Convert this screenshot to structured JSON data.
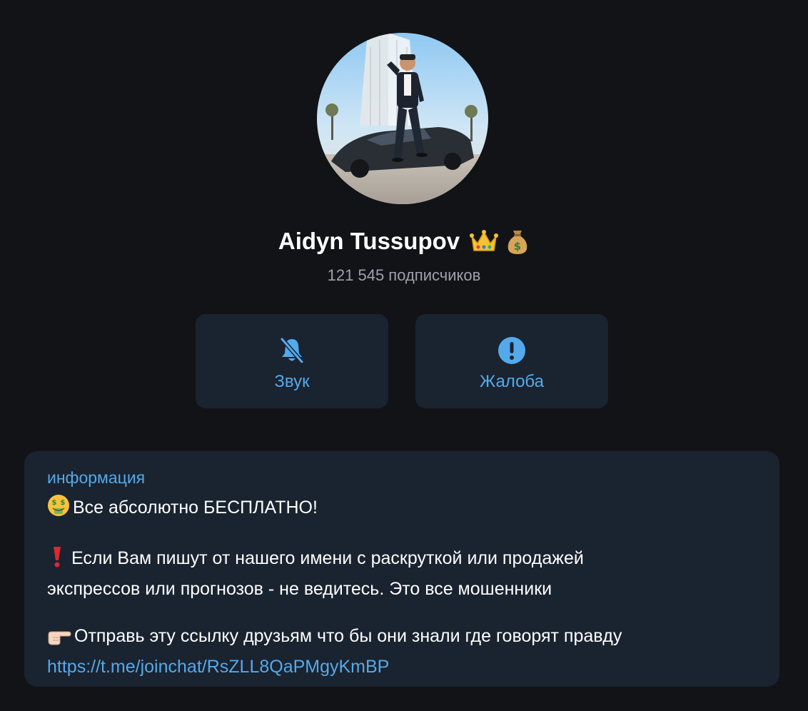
{
  "profile": {
    "name": "Aidyn Tussupov",
    "name_emojis": [
      "crown-emoji",
      "money-bag-emoji"
    ],
    "subscribers": "121 545 подписчиков"
  },
  "actions": {
    "sound_label": "Звук",
    "sound_icon": "bell-muted-icon",
    "report_label": "Жалоба",
    "report_icon": "exclamation-circle-icon"
  },
  "info": {
    "title": "информация",
    "line1": "Все абсолютно БЕСПЛАТНО!",
    "line2a": "Если Вам пишут от нашего имени с раскруткой или продажей",
    "line2b": "экспрессов или прогнозов - не ведитесь. Это все мошенники",
    "line3": "Отправь эту ссылку друзьям что бы они знали где говорят правду",
    "link": "https://t.me/joinchat/RsZLL8QaPMgyKmBP"
  },
  "colors": {
    "background": "#121316",
    "card": "#1a2330",
    "accent": "#54a9eb",
    "text": "#ffffff",
    "muted": "#9ea2a8"
  }
}
